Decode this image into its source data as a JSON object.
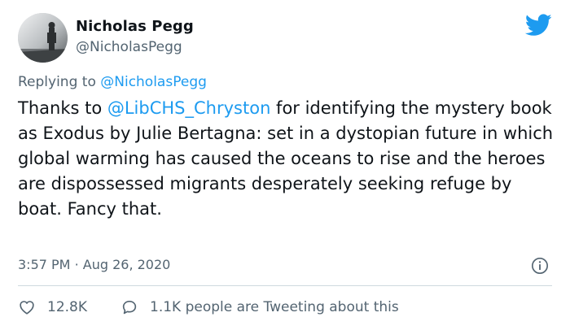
{
  "author": {
    "display_name": "Nicholas Pegg",
    "handle": "@NicholasPegg"
  },
  "reply": {
    "prefix": "Replying to",
    "mention": "@NicholasPegg"
  },
  "tweet": {
    "before": "Thanks to ",
    "mention": "@LibCHS_Chryston",
    "after": " for identifying the mystery book as Exodus by Julie Bertagna: set in a dystopian future in which global warming has caused the oceans to rise and the heroes are dispossessed migrants desperately seeking refuge by boat. Fancy that."
  },
  "meta": {
    "time": "3:57 PM",
    "separator": "·",
    "date": "Aug 26, 2020"
  },
  "actions": {
    "likes": "12.8K",
    "conversation": "1.1K people are Tweeting about this"
  },
  "colors": {
    "accent": "#1d9bf0",
    "text": "#0f1419",
    "secondary": "#536471",
    "divider": "#cfd9de"
  },
  "icons": [
    "twitter-bird-icon",
    "info-icon",
    "heart-icon",
    "speech-bubble-icon"
  ]
}
